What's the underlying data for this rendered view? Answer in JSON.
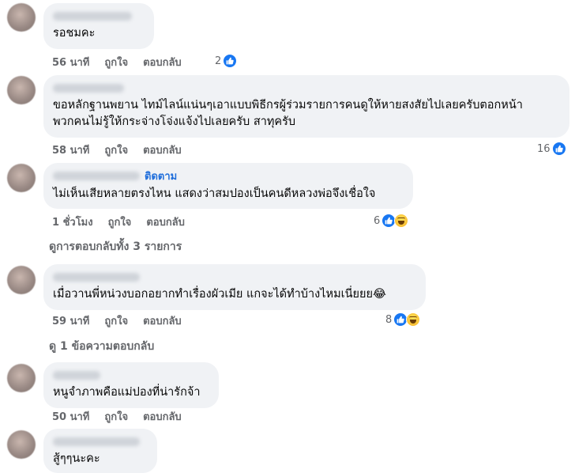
{
  "comments": [
    {
      "text": "รอชมคะ",
      "time": "56 นาที",
      "like_label": "ถูกใจ",
      "reply_label": "ตอบกลับ",
      "reactions": "2"
    },
    {
      "text": "ขอหลักฐานพยาน ไทม์ไลน์แน่นๆเอาแบบพิธีกรผู้ร่วมรายการคนดูให้หายสงสัยไปเลยครับตอกหน้า",
      "text2": "พวกคนไม่รู้ให้กระจ่างโจ่งแจ้งไปเลยครับ สาทุครับ",
      "time": "58 นาที",
      "like_label": "ถูกใจ",
      "reply_label": "ตอบกลับ",
      "reactions": "16"
    },
    {
      "follow": "ติดตาม",
      "text": "ไม่เห็นเสียหลายตรงไหน แสดงว่าสมปองเป็นคนดีหลวงพ่อจึงเชื่อใจ",
      "time": "1 ชั่วโมง",
      "like_label": "ถูกใจ",
      "reply_label": "ตอบกลับ",
      "reactions": "6",
      "view_replies": "ดูการตอบกลับทั้ง 3 รายการ"
    },
    {
      "text": "เมื่อวานพี่หน่วงบอกอยากทำเรื่องผัวเมีย แกจะได้ทำบ้างไหมเนี่ยยย😂",
      "time": "59 นาที",
      "like_label": "ถูกใจ",
      "reply_label": "ตอบกลับ",
      "reactions": "8",
      "view_replies": "ดู 1 ข้อความตอบกลับ"
    },
    {
      "text": "หนูจำภาพคือแม่ปองที่น่ารักจ้า",
      "time": "50 นาที",
      "like_label": "ถูกใจ",
      "reply_label": "ตอบกลับ"
    },
    {
      "text": "สู้ๆๆนะคะ"
    }
  ],
  "colors": {
    "like_blue": "#1877f2",
    "bubble": "#f0f2f5",
    "meta": "#65676b",
    "follow": "#216fdb"
  },
  "icons": {
    "like": "thumbs-up-icon",
    "haha": "laughing-emoji-icon"
  }
}
